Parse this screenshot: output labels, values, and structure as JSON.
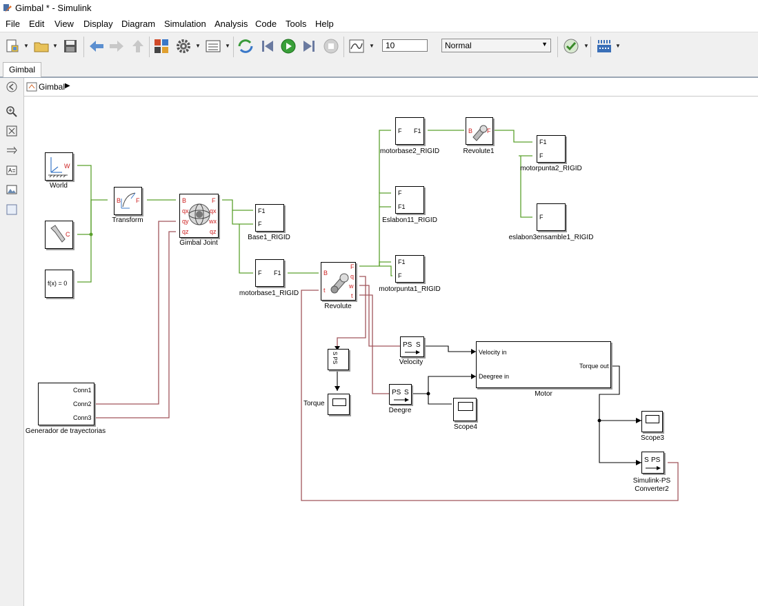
{
  "window": {
    "title": "Gimbal * - Simulink"
  },
  "menu": [
    "File",
    "Edit",
    "View",
    "Display",
    "Diagram",
    "Simulation",
    "Analysis",
    "Code",
    "Tools",
    "Help"
  ],
  "toolbar": {
    "stop_time": "10",
    "sim_mode": "Normal"
  },
  "tab": {
    "label": "Gimbal"
  },
  "breadcrumb": {
    "model": "Gimbal"
  },
  "blocks": {
    "world": {
      "label": "World",
      "port": "W"
    },
    "solver": {
      "label": "",
      "port": "C"
    },
    "fx": {
      "text": "f(x) = 0"
    },
    "transform": {
      "label": "Transform",
      "in": "B",
      "out": "F"
    },
    "gimbal": {
      "label": "Gimbal Joint",
      "in1": "B",
      "in2": "qx",
      "in3": "qy",
      "in4": "qz",
      "out1": "F",
      "out2": "qx",
      "out3": "wx",
      "out4": "qz"
    },
    "base1": {
      "label": "Base1_RIGID",
      "p1": "F1",
      "p2": "F"
    },
    "motorbase1": {
      "label": "motorbase1_RIGID",
      "p1": "F",
      "p2": "F1"
    },
    "revolute": {
      "label": "Revolute",
      "b": "B",
      "t": "t",
      "f": "F",
      "q": "q",
      "w": "w",
      "tt": "t"
    },
    "motorbase2": {
      "label": "motorbase2_RIGID",
      "p1": "F",
      "p2": "F1"
    },
    "revolute1": {
      "label": "Revolute1",
      "b": "B",
      "f": "F"
    },
    "motorpunta2": {
      "label": "motorpunta2_RIGID",
      "p1": "F1",
      "p2": "F"
    },
    "eslabon11": {
      "label": "Eslabon11_RIGID",
      "p1": "F",
      "p2": "F1"
    },
    "eslabon3": {
      "label": "eslabon3ensamble1_RIGID",
      "p1": "F"
    },
    "motorpunta1": {
      "label": "motorpunta1_RIGID",
      "p1": "F1",
      "p2": "F"
    },
    "generador": {
      "label": "Generador de trayectorias",
      "p1": "Conn1",
      "p2": "Conn2",
      "p3": "Conn3"
    },
    "torque_conv": {
      "text": "S PS"
    },
    "torque": {
      "label": "Torque"
    },
    "velocity": {
      "label": "Velocity",
      "text1": "PS",
      "text2": "S"
    },
    "deegre": {
      "label": "Deegre",
      "text1": "PS",
      "text2": "S"
    },
    "scope4": {
      "label": "Scope4"
    },
    "motor": {
      "label": "Motor",
      "in1": "Velocity in",
      "in2": "Deegree in",
      "out1": "Torque out"
    },
    "scope3": {
      "label": "Scope3"
    },
    "conv2": {
      "label1": "Simulink-PS",
      "label2": "Converter2",
      "text1": "S",
      "text2": "PS"
    }
  },
  "colors": {
    "physical_wire": "#5aa02c",
    "signal_wire": "#000000",
    "ps_wire": "#a0555a",
    "port_red": "#cc1e1e"
  }
}
